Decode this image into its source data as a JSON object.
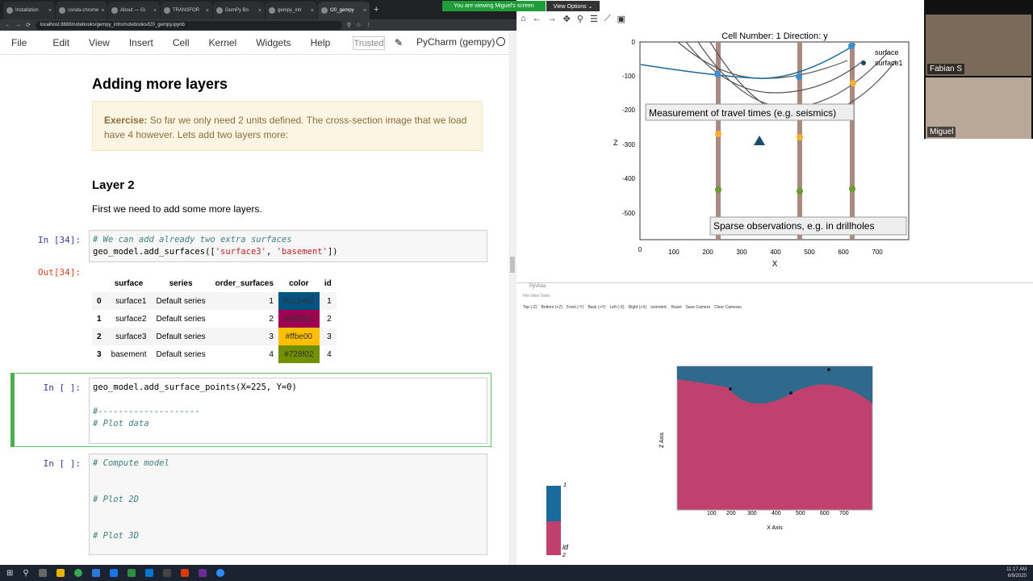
{
  "browser": {
    "tabs": [
      "Installation",
      "conda-chrome",
      "About — Gi",
      "TRANSFOR",
      "GemPy Bo",
      "gempy_intr",
      "t20_gempy"
    ],
    "address": "localhost:8888/notebooks/gempy_intro/notebooks/t20_gempy.ipynb"
  },
  "share_banner": {
    "viewing": "You are viewing Miguel's screen",
    "options": "View Options ⌄"
  },
  "menu": {
    "items": [
      "File",
      "Edit",
      "View",
      "Insert",
      "Cell",
      "Kernel",
      "Widgets",
      "Help"
    ],
    "trusted": "Trusted",
    "kernel": "PyCharm (gempy)"
  },
  "notebook": {
    "heading": "Adding more layers",
    "exercise_label": "Exercise:",
    "exercise_text": "So far we only need 2 units defined. The cross-section image that we load have 4 however. Lets add two layers more:",
    "layer_heading": "Layer 2",
    "layer_text": "First we need to add some more layers.",
    "cell34_prompt": "In [34]:",
    "cell34_comment": "# We can add already two extra surfaces",
    "cell34_code_a": "geo_model.add_surfaces([",
    "cell34_str1": "'surface3'",
    "cell34_sep": ", ",
    "cell34_str2": "'basement'",
    "cell34_code_b": "])",
    "out34_prompt": "Out[34]:",
    "table": {
      "columns": [
        "surface",
        "series",
        "order_surfaces",
        "color",
        "id"
      ],
      "rows": [
        {
          "idx": "0",
          "surface": "surface1",
          "series": "Default series",
          "order": "1",
          "color": "#015482",
          "id": "1"
        },
        {
          "idx": "1",
          "surface": "surface2",
          "series": "Default series",
          "order": "2",
          "color": "#9f0052",
          "id": "2"
        },
        {
          "idx": "2",
          "surface": "surface3",
          "series": "Default series",
          "order": "3",
          "color": "#ffbe00",
          "id": "3"
        },
        {
          "idx": "3",
          "surface": "basement",
          "series": "Default series",
          "order": "4",
          "color": "#728f02",
          "id": "4"
        }
      ]
    },
    "cell_active_prompt": "In [ ]:",
    "cell_active_code": "geo_model.add_surface_points(X=225, Y=0)",
    "cell_active_sep": "#--------------------",
    "cell_active_comment": "# Plot data",
    "cell_next_prompt": "In [ ]:",
    "cell_next_c1": "# Compute model",
    "cell_next_c2": "# Plot 2D",
    "cell_next_c3": "# Plot 3D"
  },
  "plot2d": {
    "title": "Cell Number: 1 Direction: y",
    "ylabel": "Z",
    "xlabel": "X",
    "legend": [
      "surface",
      "surface1"
    ],
    "annotation_top": "Measurement of travel times (e.g. seismics)",
    "annotation_bottom": "Sparse observations, e.g. in drillholes",
    "yticks": [
      "0",
      "-100",
      "-200",
      "-300",
      "-400",
      "-500"
    ],
    "xticks": [
      "0",
      "100",
      "200",
      "300",
      "400",
      "500",
      "600",
      "700"
    ]
  },
  "pyvista": {
    "title": "PyVista",
    "menu": "File   View   Tools",
    "buttons": [
      "Top (-Z)",
      "Bottom (+Z)",
      "Front (-Y)",
      "Back (+Y)",
      "Left (-X)",
      "Right (+X)",
      "Isometric",
      "Reset",
      "Save Camera",
      "Clear Cameras"
    ],
    "xaxis_label": "X Axis",
    "zaxis_label": "Z Axis",
    "xticks": [
      "100",
      "200",
      "300",
      "400",
      "500",
      "600",
      "700"
    ],
    "colorbar_top": "1",
    "colorbar_label": "id",
    "colorbar_bottom": "2"
  },
  "video": {
    "person1": "Fabian S",
    "person2": "Miguel"
  },
  "taskbar": {
    "time": "11:17 AM",
    "date": "6/9/2020"
  }
}
